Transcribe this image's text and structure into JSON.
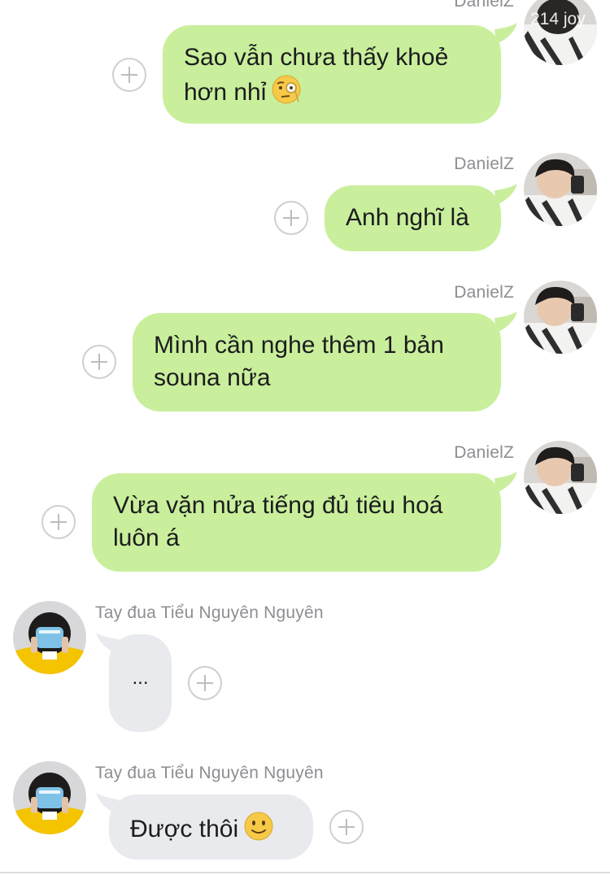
{
  "messages": [
    {
      "sender": "DanielZ",
      "direction": "outgoing",
      "text": "Sao vẫn chưa thấy khoẻ\nhơn nhỉ",
      "emoji": "face-with-monocle",
      "overlay_text": "214 joy"
    },
    {
      "sender": "DanielZ",
      "direction": "outgoing",
      "text": "Anh nghĩ là"
    },
    {
      "sender": "DanielZ",
      "direction": "outgoing",
      "text": "Mình cần nghe thêm 1 bản\nsouna nữa"
    },
    {
      "sender": "DanielZ",
      "direction": "outgoing",
      "text": "Vừa vặn nửa tiếng đủ tiêu hoá\nluôn á"
    },
    {
      "sender": "Tay đua Tiểu Nguyên Nguyên",
      "direction": "incoming",
      "text": "..."
    },
    {
      "sender": "Tay đua Tiểu Nguyên Nguyên",
      "direction": "incoming",
      "text": "Được thôi",
      "emoji": "slightly-smiling-face"
    }
  ],
  "colors": {
    "outgoing_bubble": "#c9ef9c",
    "incoming_bubble": "#e9eaed",
    "name_text": "#8e8e93",
    "add_button": "#cfcfd3"
  },
  "icons": {
    "add_reaction": "plus-circle-icon"
  }
}
